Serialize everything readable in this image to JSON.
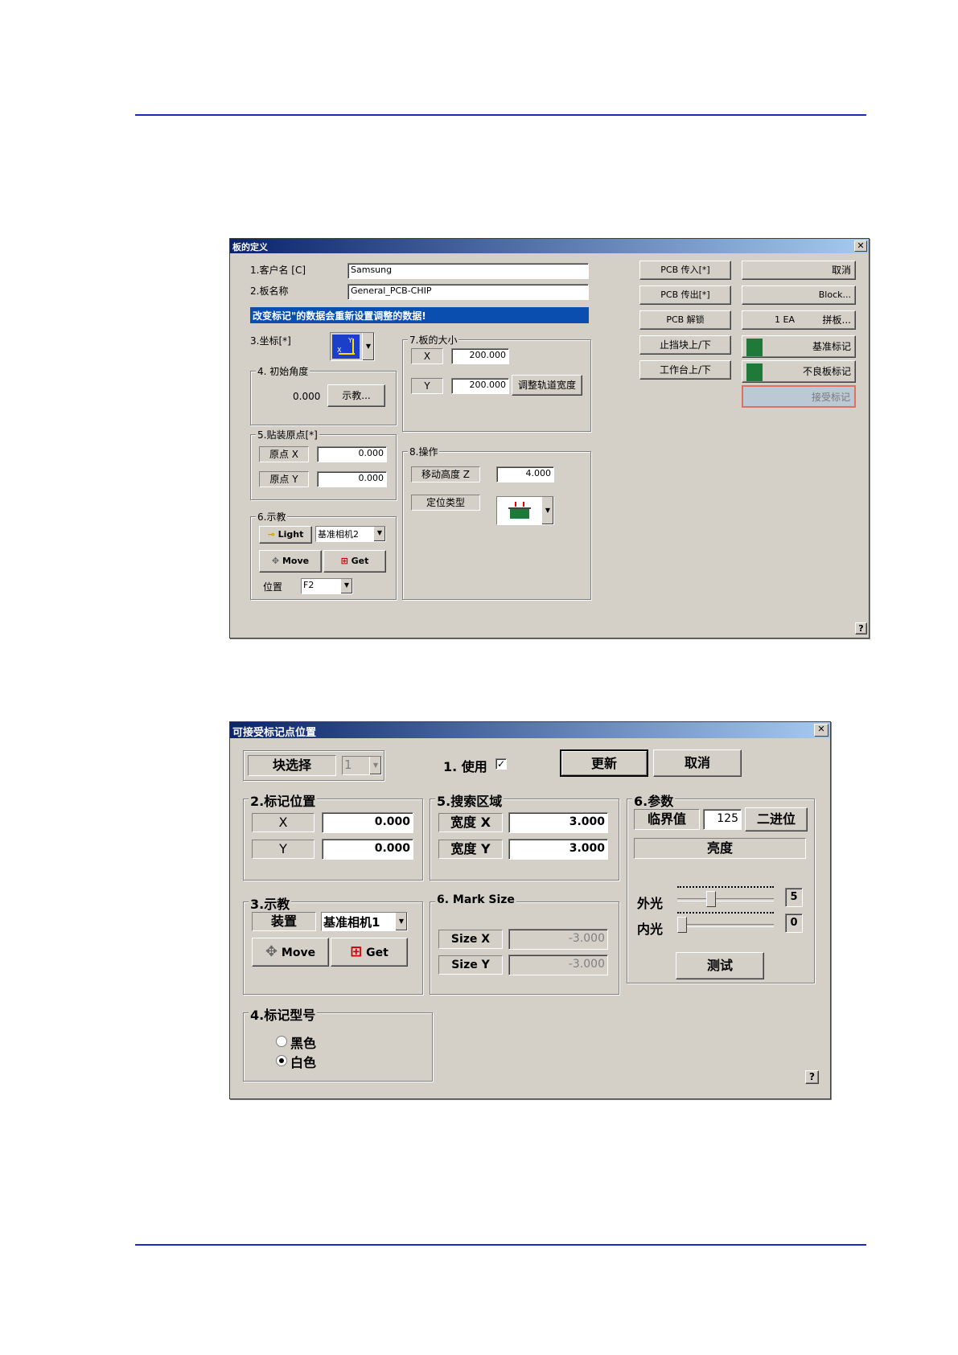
{
  "dialog1": {
    "title": "板的定义",
    "close": "✕",
    "customer": {
      "label": "1.客户名 [C]",
      "value": "Samsung"
    },
    "board_name": {
      "label": "2.板名称",
      "value": "General_PCB-CHIP"
    },
    "warning": "改变标记\"的数据会重新设置调整的数据!",
    "coord": {
      "label": "3.坐标[*]"
    },
    "init_angle": {
      "title": "4. 初始角度",
      "value": "0.000",
      "teach_button": "示教..."
    },
    "origin": {
      "title": "5.贴装原点[*]",
      "x_label": "原点 X",
      "x_value": "0.000",
      "y_label": "原点 Y",
      "y_value": "0.000"
    },
    "teach": {
      "title": "6.示教",
      "light_button": "Light",
      "camera_value": "基准相机2",
      "move_button": "Move",
      "get_button": "Get",
      "position_label": "位置",
      "position_value": "F2"
    },
    "board_size": {
      "title": "7.板的大小",
      "x_label": "X",
      "x_value": "200.000",
      "y_label": "Y",
      "y_value": "200.000",
      "adjust_button": "调整轨道宽度"
    },
    "operation": {
      "title": "8.操作",
      "move_height_label": "移动高度 Z",
      "move_height_value": "4.000",
      "position_type_label": "定位类型"
    },
    "right_buttons": {
      "pcb_in": "PCB 传入[*]",
      "pcb_out": "PCB 传出[*]",
      "pcb_unlock": "PCB 解锁",
      "stopper": "止挡块上/下",
      "table": "工作台上/下",
      "cancel": "取消",
      "block": "Block...",
      "panel_count": "1 EA",
      "panel_button": "拼板...",
      "fiducial": "基准标记",
      "bad_mark": "不良板标记",
      "accept_mark": "接受标记"
    },
    "help": "?"
  },
  "dialog2": {
    "title": "可接受标记点位置",
    "close": "✕",
    "block_select": {
      "label": "块选择",
      "value": "1"
    },
    "use": {
      "label": "1. 使用",
      "checked": true
    },
    "update_button": "更新",
    "cancel_button": "取消",
    "mark_position": {
      "title": "2.标记位置",
      "x_label": "X",
      "x_value": "0.000",
      "y_label": "Y",
      "y_value": "0.000"
    },
    "search_area": {
      "title": "5.搜索区域",
      "wx_label": "宽度 X",
      "wx_value": "3.000",
      "wy_label": "宽度 Y",
      "wy_value": "3.000"
    },
    "params": {
      "title": "6.参数",
      "threshold_label": "临界值",
      "threshold_value": "125",
      "binary_button": "二进位",
      "brightness_label": "亮度",
      "outer_label": "外光",
      "outer_value": "5",
      "outer_level": 0.33,
      "inner_label": "内光",
      "inner_value": "0",
      "inner_level": 0,
      "test_button": "测试"
    },
    "teach": {
      "title": "3.示教",
      "device_label": "装置",
      "camera_value": "基准相机1",
      "move_button": "Move",
      "get_button": "Get"
    },
    "mark_size": {
      "title": "6. Mark Size",
      "sx_label": "Size X",
      "sx_value": "-3.000",
      "sy_label": "Size Y",
      "sy_value": "-3.000"
    },
    "mark_type": {
      "title": "4.标记型号",
      "black_label": "黑色",
      "white_label": "白色",
      "selected": "白色"
    },
    "help": "?"
  }
}
